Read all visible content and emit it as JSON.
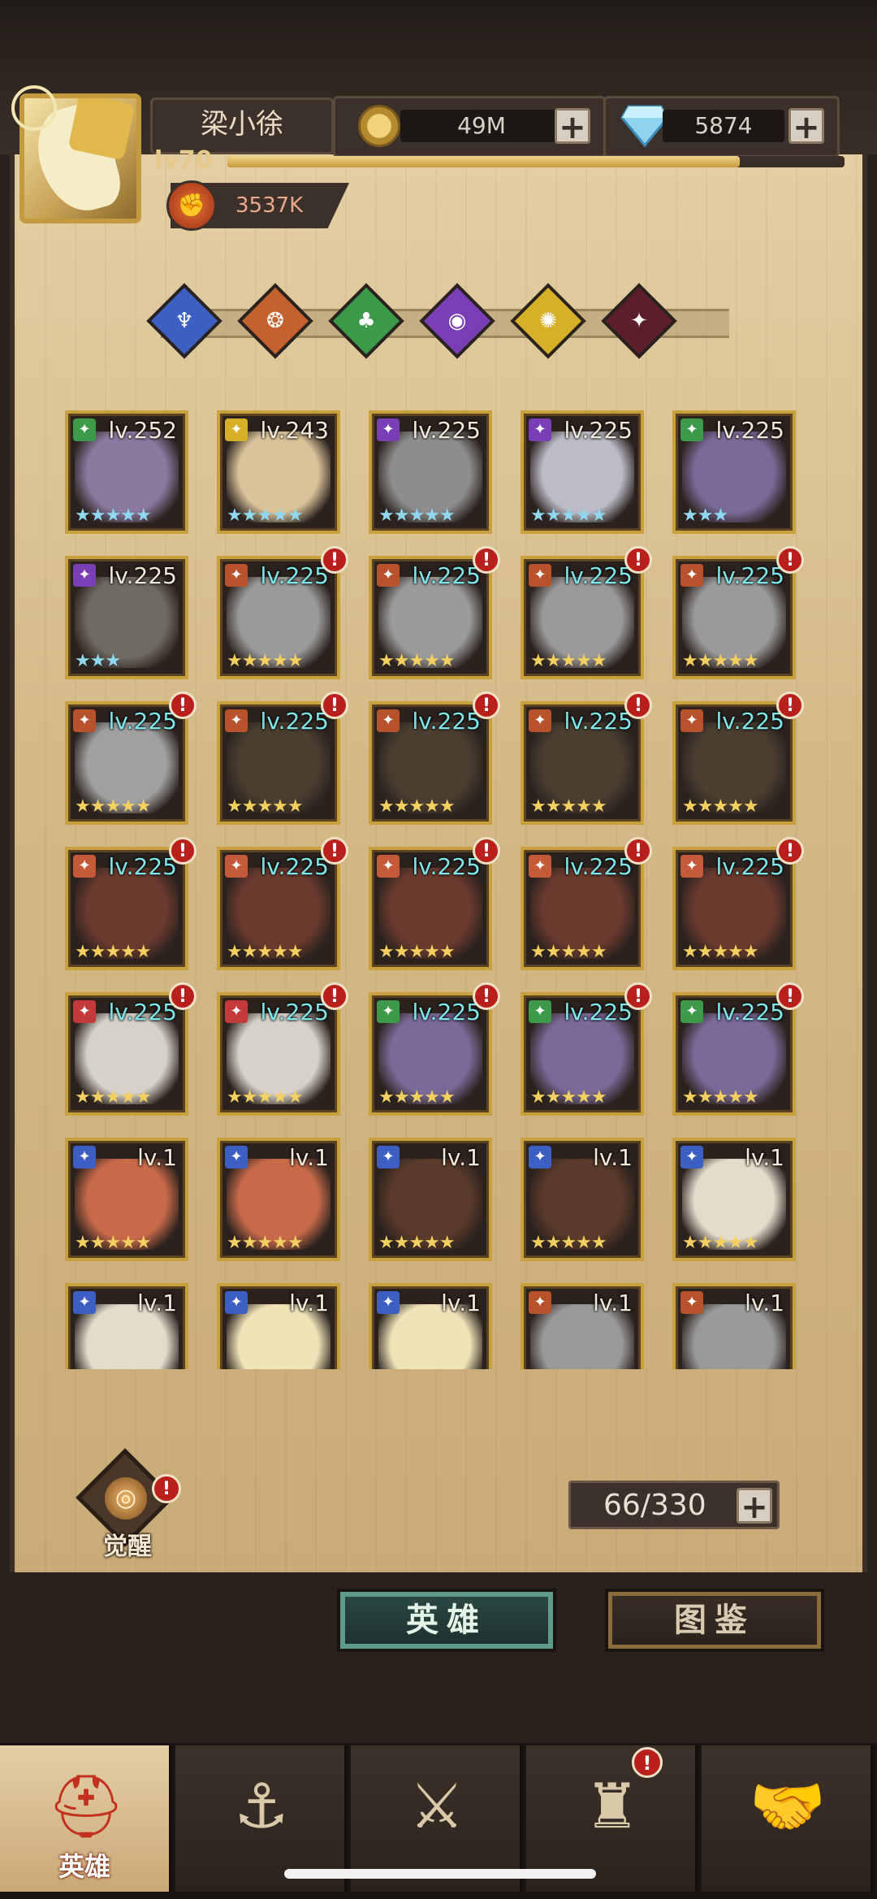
{
  "player": {
    "name": "梁小徐",
    "level": "lv70",
    "power": "3537K",
    "xp_fraction": 0.83
  },
  "resources": {
    "gold": "49M",
    "diamonds": "5874",
    "add": "+"
  },
  "filters": [
    {
      "name": "filter-blue",
      "color": "#3d5fc4",
      "glyph": "♆"
    },
    {
      "name": "filter-orange",
      "color": "#c4622e",
      "glyph": "❂"
    },
    {
      "name": "filter-green",
      "color": "#3b9a4a",
      "glyph": "♣"
    },
    {
      "name": "filter-purple",
      "color": "#7a3fb6",
      "glyph": "◉"
    },
    {
      "name": "filter-gold",
      "color": "#d8b028",
      "glyph": "✺"
    },
    {
      "name": "filter-dark",
      "color": "#5a1f2a",
      "glyph": "✦"
    }
  ],
  "heroes": [
    {
      "level": "lv.252",
      "stars": "★★★★★",
      "star_color": "#8fd8ef",
      "class_color": "#3c9a4a",
      "face": "#8a7aa0",
      "cyan": false,
      "alert": false
    },
    {
      "level": "lv.243",
      "stars": "★★★★★",
      "star_color": "#8fd8ef",
      "class_color": "#d8b028",
      "face": "#d9c39a",
      "cyan": false,
      "alert": false
    },
    {
      "level": "lv.225",
      "stars": "★★★★★",
      "star_color": "#8fd8ef",
      "class_color": "#7a3fb6",
      "face": "#8d8d8d",
      "cyan": false,
      "alert": false
    },
    {
      "level": "lv.225",
      "stars": "★★★★★",
      "star_color": "#8fd8ef",
      "class_color": "#7a3fb6",
      "face": "#bcbcc8",
      "cyan": false,
      "alert": false
    },
    {
      "level": "lv.225",
      "stars": "★★★",
      "star_color": "#8fd8ef",
      "class_color": "#3c9a4a",
      "face": "#7a6a98",
      "cyan": false,
      "alert": false
    },
    {
      "level": "lv.225",
      "stars": "★★★",
      "star_color": "#8fd8ef",
      "class_color": "#7a3fb6",
      "face": "#6f6a62",
      "cyan": false,
      "alert": false
    },
    {
      "level": "lv.225",
      "stars": "★★★★★",
      "star_color": "#f3d060",
      "class_color": "#b8522c",
      "face": "#9a9a9a",
      "cyan": true,
      "alert": true
    },
    {
      "level": "lv.225",
      "stars": "★★★★★",
      "star_color": "#f3d060",
      "class_color": "#b8522c",
      "face": "#9a9a9a",
      "cyan": true,
      "alert": true
    },
    {
      "level": "lv.225",
      "stars": "★★★★★",
      "star_color": "#f3d060",
      "class_color": "#b8522c",
      "face": "#9a9a9a",
      "cyan": true,
      "alert": true
    },
    {
      "level": "lv.225",
      "stars": "★★★★★",
      "star_color": "#f3d060",
      "class_color": "#b8522c",
      "face": "#9a9a9a",
      "cyan": true,
      "alert": true
    },
    {
      "level": "lv.225",
      "stars": "★★★★★",
      "star_color": "#f3d060",
      "class_color": "#b8522c",
      "face": "#a0a0a0",
      "cyan": true,
      "alert": true
    },
    {
      "level": "lv.225",
      "stars": "★★★★★",
      "star_color": "#f3d060",
      "class_color": "#b8522c",
      "face": "#4a3e30",
      "cyan": true,
      "alert": true
    },
    {
      "level": "lv.225",
      "stars": "★★★★★",
      "star_color": "#f3d060",
      "class_color": "#b8522c",
      "face": "#4a3e30",
      "cyan": true,
      "alert": true
    },
    {
      "level": "lv.225",
      "stars": "★★★★★",
      "star_color": "#f3d060",
      "class_color": "#b8522c",
      "face": "#4a3e30",
      "cyan": true,
      "alert": true
    },
    {
      "level": "lv.225",
      "stars": "★★★★★",
      "star_color": "#f3d060",
      "class_color": "#b8522c",
      "face": "#4a3e30",
      "cyan": true,
      "alert": true
    },
    {
      "level": "lv.225",
      "stars": "★★★★★",
      "star_color": "#f3d060",
      "class_color": "#c45a3a",
      "face": "#6a3a2e",
      "cyan": true,
      "alert": true
    },
    {
      "level": "lv.225",
      "stars": "★★★★★",
      "star_color": "#f3d060",
      "class_color": "#c45a3a",
      "face": "#6a3a2e",
      "cyan": true,
      "alert": true
    },
    {
      "level": "lv.225",
      "stars": "★★★★★",
      "star_color": "#f3d060",
      "class_color": "#c45a3a",
      "face": "#6a3a2e",
      "cyan": true,
      "alert": true
    },
    {
      "level": "lv.225",
      "stars": "★★★★★",
      "star_color": "#f3d060",
      "class_color": "#c45a3a",
      "face": "#6a3a2e",
      "cyan": true,
      "alert": true
    },
    {
      "level": "lv.225",
      "stars": "★★★★★",
      "star_color": "#f3d060",
      "class_color": "#c45a3a",
      "face": "#6a3a2e",
      "cyan": true,
      "alert": true
    },
    {
      "level": "lv.225",
      "stars": "★★★★★",
      "star_color": "#f3d060",
      "class_color": "#c43a3a",
      "face": "#d6d2c8",
      "cyan": true,
      "alert": true
    },
    {
      "level": "lv.225",
      "stars": "★★★★★",
      "star_color": "#f3d060",
      "class_color": "#c43a3a",
      "face": "#d6d2c8",
      "cyan": true,
      "alert": true
    },
    {
      "level": "lv.225",
      "stars": "★★★★★",
      "star_color": "#f3d060",
      "class_color": "#3c9a4a",
      "face": "#7a6a98",
      "cyan": true,
      "alert": true
    },
    {
      "level": "lv.225",
      "stars": "★★★★★",
      "star_color": "#f3d060",
      "class_color": "#3c9a4a",
      "face": "#7a6a98",
      "cyan": true,
      "alert": true
    },
    {
      "level": "lv.225",
      "stars": "★★★★★",
      "star_color": "#f3d060",
      "class_color": "#3c9a4a",
      "face": "#7a6a98",
      "cyan": true,
      "alert": true
    },
    {
      "level": "lv.1",
      "stars": "★★★★★",
      "star_color": "#f3d060",
      "class_color": "#3d5fc4",
      "face": "#c86a4a",
      "cyan": false,
      "alert": false
    },
    {
      "level": "lv.1",
      "stars": "★★★★★",
      "star_color": "#f3d060",
      "class_color": "#3d5fc4",
      "face": "#c86a4a",
      "cyan": false,
      "alert": false
    },
    {
      "level": "lv.1",
      "stars": "★★★★★",
      "star_color": "#f3d060",
      "class_color": "#3d5fc4",
      "face": "#5a3a2a",
      "cyan": false,
      "alert": false
    },
    {
      "level": "lv.1",
      "stars": "★★★★★",
      "star_color": "#f3d060",
      "class_color": "#3d5fc4",
      "face": "#5a3a2a",
      "cyan": false,
      "alert": false
    },
    {
      "level": "lv.1",
      "stars": "★★★★★",
      "star_color": "#f3d060",
      "class_color": "#3d5fc4",
      "face": "#e3dccb",
      "cyan": false,
      "alert": false
    },
    {
      "level": "lv.1",
      "stars": "",
      "star_color": "#f3d060",
      "class_color": "#3d5fc4",
      "face": "#e3dccb",
      "cyan": false,
      "alert": false
    },
    {
      "level": "lv.1",
      "stars": "",
      "star_color": "#f3d060",
      "class_color": "#3d5fc4",
      "face": "#efe3b8",
      "cyan": false,
      "alert": false
    },
    {
      "level": "lv.1",
      "stars": "",
      "star_color": "#f3d060",
      "class_color": "#3d5fc4",
      "face": "#efe3b8",
      "cyan": false,
      "alert": false
    },
    {
      "level": "lv.1",
      "stars": "",
      "star_color": "#f3d060",
      "class_color": "#b8522c",
      "face": "#9a9a9a",
      "cyan": false,
      "alert": false
    },
    {
      "level": "lv.1",
      "stars": "",
      "star_color": "#f3d060",
      "class_color": "#b8522c",
      "face": "#9a9a9a",
      "cyan": false,
      "alert": false
    }
  ],
  "awaken": {
    "label": "觉醒",
    "alert": "!"
  },
  "hero_count": "66/330",
  "tabs": {
    "heroes": "英雄",
    "codex": "图鉴"
  },
  "bottom_nav": [
    {
      "label": "英雄",
      "active": true,
      "alert": false
    },
    {
      "label": "",
      "active": false,
      "alert": false
    },
    {
      "label": "",
      "active": false,
      "alert": false
    },
    {
      "label": "",
      "active": false,
      "alert": true
    },
    {
      "label": "",
      "active": false,
      "alert": false
    }
  ],
  "alert_glyph": "!"
}
